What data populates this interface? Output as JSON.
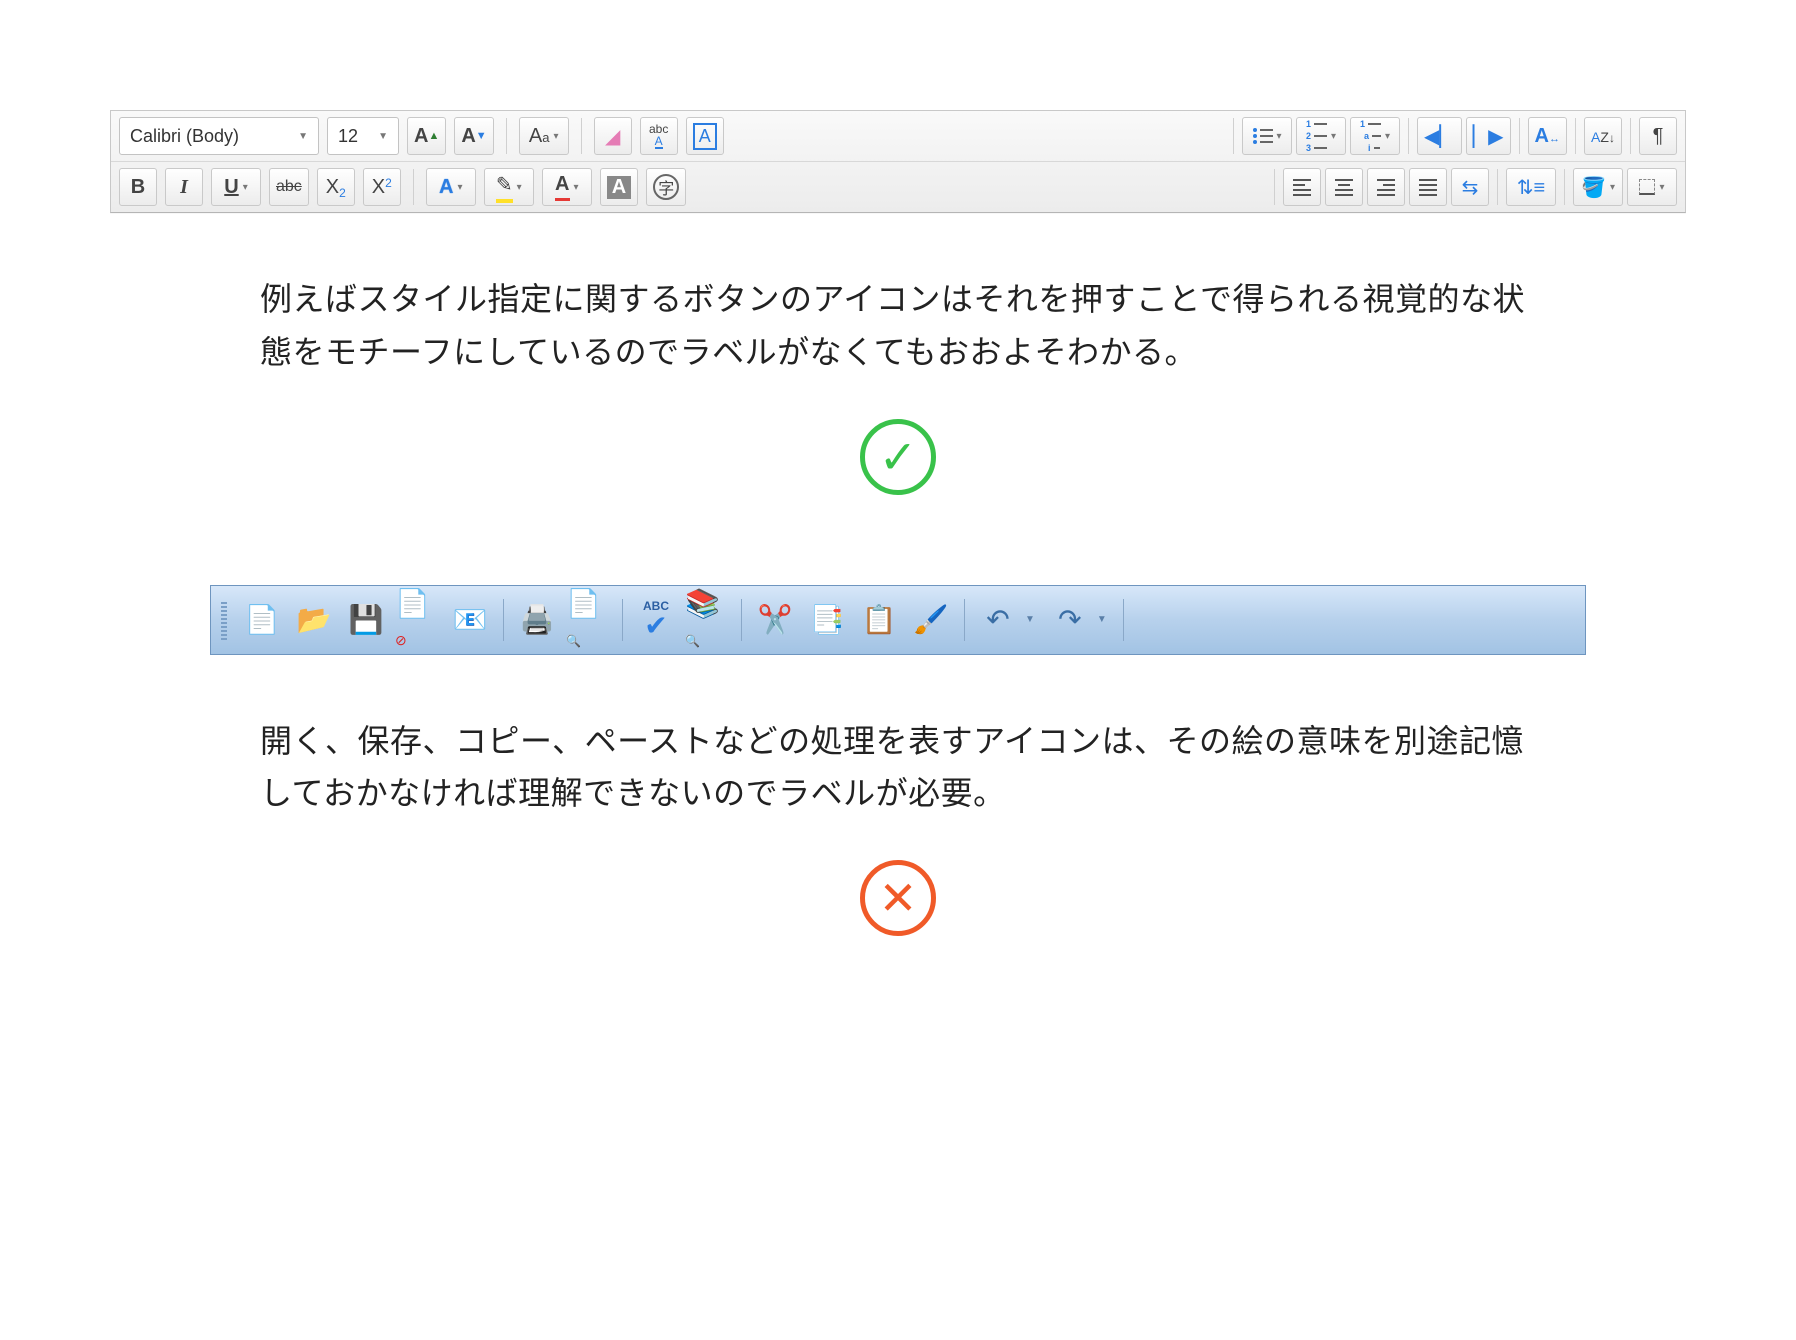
{
  "example1": {
    "font_name": "Calibri (Body)",
    "font_size": "12",
    "caption": "例えばスタイル指定に関するボタンのアイコンはそれを押すことで得られる視覚的な状態をモチーフにしているのでラベルがなくてもおおよそわかる。"
  },
  "example2": {
    "caption": "開く、保存、コピー、ペーストなどの処理を表すアイコンは、その絵の意味を別途記憶しておかなければ理解できないのでラベルが必要。"
  },
  "toolbar1": {
    "bold": "B",
    "italic": "I",
    "underline": "U",
    "strike": "abc",
    "subscript": "X",
    "superscript": "X",
    "char_style_A": "A",
    "abc_label": "abc",
    "char_kanji": "字"
  },
  "status": {
    "good": "✓",
    "bad": "✕"
  }
}
